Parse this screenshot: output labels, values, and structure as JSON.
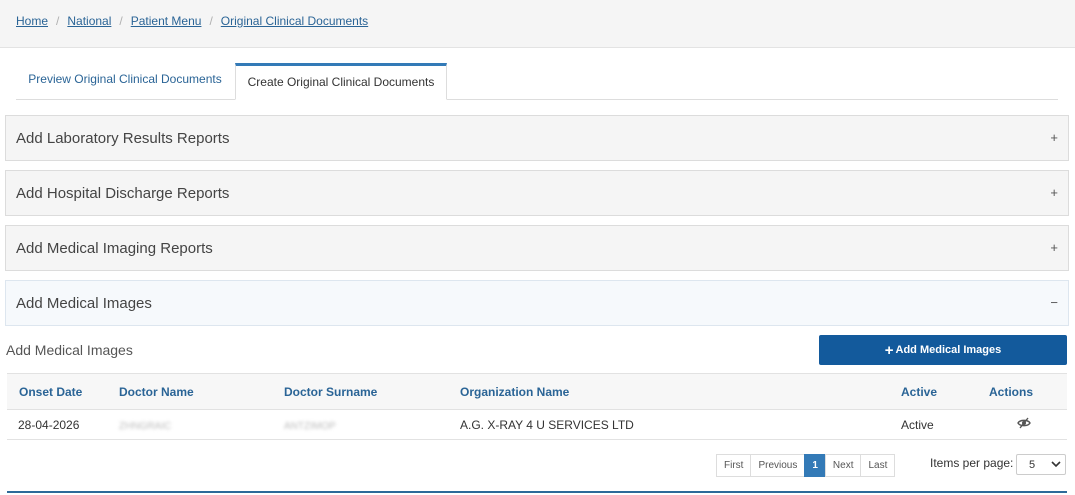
{
  "breadcrumb": {
    "items": [
      "Home",
      "National",
      "Patient Menu",
      "Original Clinical Documents"
    ],
    "separator": "/"
  },
  "tabs": [
    {
      "label": "Preview Original Clinical Documents",
      "active": false
    },
    {
      "label": "Create Original Clinical Documents",
      "active": true
    }
  ],
  "panels": [
    {
      "title": "Add Laboratory Results Reports",
      "toggle": "+",
      "expanded": false
    },
    {
      "title": "Add Hospital Discharge Reports",
      "toggle": "+",
      "expanded": false
    },
    {
      "title": "Add Medical Imaging Reports",
      "toggle": "+",
      "expanded": false
    },
    {
      "title": "Add Medical Images",
      "toggle": "−",
      "expanded": true
    }
  ],
  "medical_images": {
    "subtitle": "Add Medical Images",
    "add_button_label": "Add Medical Images",
    "add_button_icon": "plus-icon",
    "columns": [
      "Onset Date",
      "Doctor Name",
      "Doctor Surname",
      "Organization Name",
      "Active",
      "Actions"
    ],
    "rows": [
      {
        "onset_date": "28-04-2026",
        "doctor_name": "ZHNGRAIC",
        "doctor_surname": "ANTZIMOP",
        "organization": "A.G. X-RAY 4 U SERVICES LTD",
        "active": "Active",
        "action_icon": "eye-slash-icon"
      }
    ]
  },
  "pagination": {
    "first": "First",
    "previous": "Previous",
    "current": "1",
    "next": "Next",
    "last": "Last"
  },
  "items_per_page": {
    "label": "Items per page:",
    "value": "5"
  },
  "colors": {
    "link": "#2a6496",
    "primary_button": "#135a9c",
    "active_tab_border": "#337ab7",
    "pager_active": "#337ab7"
  }
}
